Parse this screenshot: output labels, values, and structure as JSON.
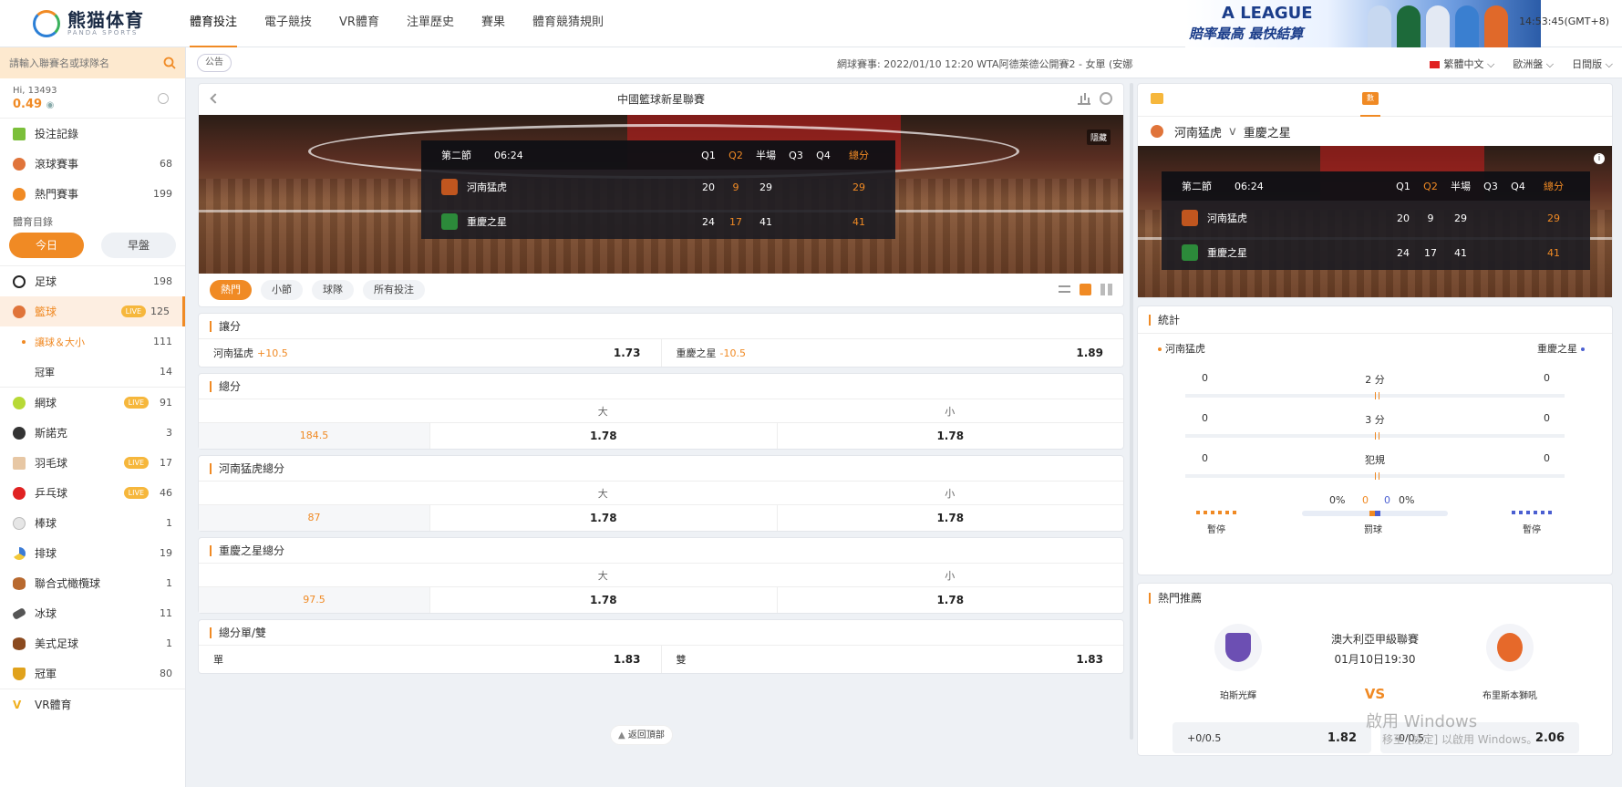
{
  "header": {
    "logo_name": "熊猫体育",
    "logo_sub": "PANDA SPORTS",
    "nav": [
      "體育投注",
      "電子競技",
      "VR體育",
      "注單歷史",
      "賽果",
      "體育競猜規則"
    ],
    "banner_title": "A LEAGUE",
    "banner_sub": "賠率最高 最快結算",
    "clock": "14:53:45(GMT+8)"
  },
  "toolbar": {
    "search_placeholder": "請輸入聯賽名或球隊名",
    "notice_label": "公告",
    "marquee": "網球賽事: 2022/01/10 12:20 WTA阿德萊德公開賽2 - 女單 (安娜我",
    "language": "繁體中文",
    "odds_type": "歐洲盤",
    "view_mode": "日間版"
  },
  "user": {
    "greeting": "Hi, 13493",
    "balance": "0.49"
  },
  "sidebar": {
    "top_items": [
      {
        "label": "投注記錄",
        "count": "",
        "color": "#7bbf3a"
      },
      {
        "label": "滾球賽事",
        "count": "68",
        "color": "#e0743a"
      },
      {
        "label": "熱門賽事",
        "count": "199",
        "color": "#f08a24"
      }
    ],
    "catalog_title": "體育目錄",
    "day_tabs": [
      "今日",
      "早盤"
    ],
    "live_label": "LIVE",
    "sports": [
      {
        "label": "足球",
        "count": "198",
        "live": false,
        "color": "#222"
      },
      {
        "label": "籃球",
        "count": "125",
        "live": true,
        "color": "#e0743a"
      },
      {
        "label": "網球",
        "count": "91",
        "live": true,
        "color": "#b7d936"
      },
      {
        "label": "斯諾克",
        "count": "3",
        "live": false,
        "color": "#333"
      },
      {
        "label": "羽毛球",
        "count": "17",
        "live": true,
        "color": "#e7c7a4"
      },
      {
        "label": "乒乓球",
        "count": "46",
        "live": true,
        "color": "#e02222"
      },
      {
        "label": "棒球",
        "count": "1",
        "live": false,
        "color": "#cfcfcf"
      },
      {
        "label": "排球",
        "count": "19",
        "live": false,
        "color": "#3b7bd6"
      },
      {
        "label": "聯合式橄欖球",
        "count": "1",
        "live": false,
        "color": "#b8692f"
      },
      {
        "label": "冰球",
        "count": "11",
        "live": false,
        "color": "#555"
      },
      {
        "label": "美式足球",
        "count": "1",
        "live": false,
        "color": "#8b4a1f"
      },
      {
        "label": "冠軍",
        "count": "80",
        "live": false,
        "color": "#e0a21c"
      },
      {
        "label": "VR體育",
        "count": "",
        "live": false,
        "color": "#f0b020"
      }
    ],
    "basketball_sub": [
      {
        "label": "讓球＆大小",
        "count": "111"
      },
      {
        "label": "冠軍",
        "count": "14"
      }
    ]
  },
  "match": {
    "league": "中國籃球新星聯賽",
    "hidden_tag": "隱藏",
    "period": "第二節",
    "time": "06:24",
    "cols": [
      "Q1",
      "Q2",
      "半場",
      "Q3",
      "Q4",
      "總分"
    ],
    "teams": [
      {
        "name": "河南猛虎",
        "scores": [
          "20",
          "9",
          "29",
          "",
          "",
          "29"
        ],
        "color": "#c0561f"
      },
      {
        "name": "重慶之星",
        "scores": [
          "24",
          "17",
          "41",
          "",
          "",
          "41"
        ],
        "color": "#2c8a3a"
      }
    ]
  },
  "bet_tabs": [
    "熱門",
    "小節",
    "球隊",
    "所有投注"
  ],
  "markets": {
    "handicap": {
      "title": "讓分",
      "home": "河南猛虎",
      "home_line": "+10.5",
      "home_odds": "1.73",
      "away": "重慶之星",
      "away_line": "-10.5",
      "away_odds": "1.89"
    },
    "totals": [
      {
        "title": "總分",
        "over": "大",
        "under": "小",
        "line": "184.5",
        "over_odds": "1.78",
        "under_odds": "1.78"
      },
      {
        "title": "河南猛虎總分",
        "over": "大",
        "under": "小",
        "line": "87",
        "over_odds": "1.78",
        "under_odds": "1.78"
      },
      {
        "title": "重慶之星總分",
        "over": "大",
        "under": "小",
        "line": "97.5",
        "over_odds": "1.78",
        "under_odds": "1.78"
      }
    ],
    "oddeven": {
      "title": "總分單/雙",
      "odd": "單",
      "odd_odds": "1.83",
      "even": "雙",
      "even_odds": "1.83"
    },
    "back_to_top": "返回頂部"
  },
  "right": {
    "tab2_label": "數",
    "home": "河南猛虎",
    "vs": "v",
    "away": "重慶之星",
    "stats_title": "統計",
    "stats": [
      {
        "label": "2 分",
        "home": "0",
        "away": "0"
      },
      {
        "label": "3 分",
        "home": "0",
        "away": "0"
      },
      {
        "label": "犯規",
        "home": "0",
        "away": "0"
      }
    ],
    "timeout_label": "暫停",
    "ft_label": "罰球",
    "ft_home_pct": "0%",
    "ft_home": "0",
    "ft_away": "0",
    "ft_away_pct": "0%",
    "hot_title": "熱門推薦",
    "hot": {
      "league": "澳大利亞甲級聯賽",
      "time": "01月10日19:30",
      "vs": "VS",
      "home": "珀斯光輝",
      "away": "布里斯本獅吼",
      "home_line": "+0/0.5",
      "home_odds": "1.82",
      "away_line": "-0/0.5",
      "away_odds": "2.06"
    },
    "watermark1": "啟用 Windows",
    "watermark2": "移至 [設定] 以啟用 Windows。"
  }
}
